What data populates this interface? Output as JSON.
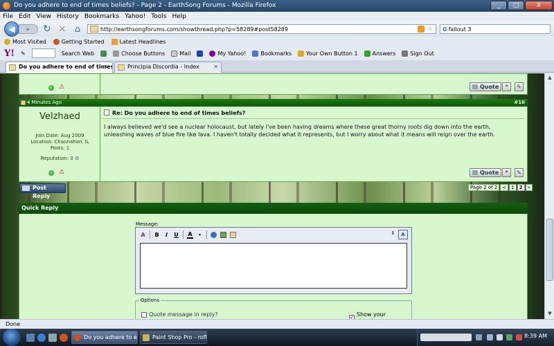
{
  "window": {
    "title": "Do you adhere to end of times beliefs? - Page 2 - EarthSong Forums - Mozilla Firefox",
    "buttons": [
      "_",
      "□",
      "X"
    ]
  },
  "menu": [
    "File",
    "Edit",
    "View",
    "History",
    "Bookmarks",
    "Yahoo!",
    "Tools",
    "Help"
  ],
  "nav": {
    "url": "http://earthsongforums.com/showthread.php?p=58289#post58289",
    "search_value": "fallout 3",
    "search_engine": "G"
  },
  "bookmarks": [
    "Most Visited",
    "Getting Started",
    "Latest Headlines"
  ],
  "yahoo_toolbar": {
    "logo": "Y!",
    "items": [
      "Search Web",
      "Choose Buttons",
      "Mail",
      "My Yahoo!",
      "Bookmarks",
      "Your Own Button 1",
      "Answers",
      "Sign Out"
    ]
  },
  "tabs": [
    {
      "label": "Do you adhere to end of times beliefs?",
      "active": true
    },
    {
      "label": "Principia Discordia - Index",
      "active": false
    }
  ],
  "post_actions": {
    "quote_label": "Quote"
  },
  "post": {
    "time": "4 Minutes Ago",
    "number": "#16",
    "username": "Velzhaed",
    "join_date": "Join Date: Aug 2009",
    "location": "Location: Channahon, IL",
    "posts": "Posts: 1",
    "reputation": "Reputation: 0",
    "title": "Re: Do you adhere to end of times beliefs?",
    "body": "I always believed we'd see a nuclear holocaust, but lately I've been having dreams where these great thorny roots dig down into the earth, unleashing waves of blue fire like lava. I haven't totally decided what it represents, but I worry about what it means will reign over the earth."
  },
  "post_reply_label": "Post Reply",
  "pager": {
    "label": "Page 2 of 2",
    "prev": "<",
    "pages": [
      "1",
      "2"
    ],
    "current": "2",
    "last": "»"
  },
  "quick_reply": {
    "title": "Quick Reply",
    "message_label": "Message:",
    "toolbar": [
      "B",
      "I",
      "U",
      "A"
    ],
    "options_label": "Options",
    "quote_option": "Quote message in reply?",
    "quote_checked": false,
    "signature_option": "Show your signature",
    "signature_checked": true
  },
  "status_text": "Done",
  "taskbar": {
    "tasks": [
      "Do you adhere to en...",
      "Paint Shop Pro - rofl..."
    ],
    "clock": "8:39 AM"
  }
}
